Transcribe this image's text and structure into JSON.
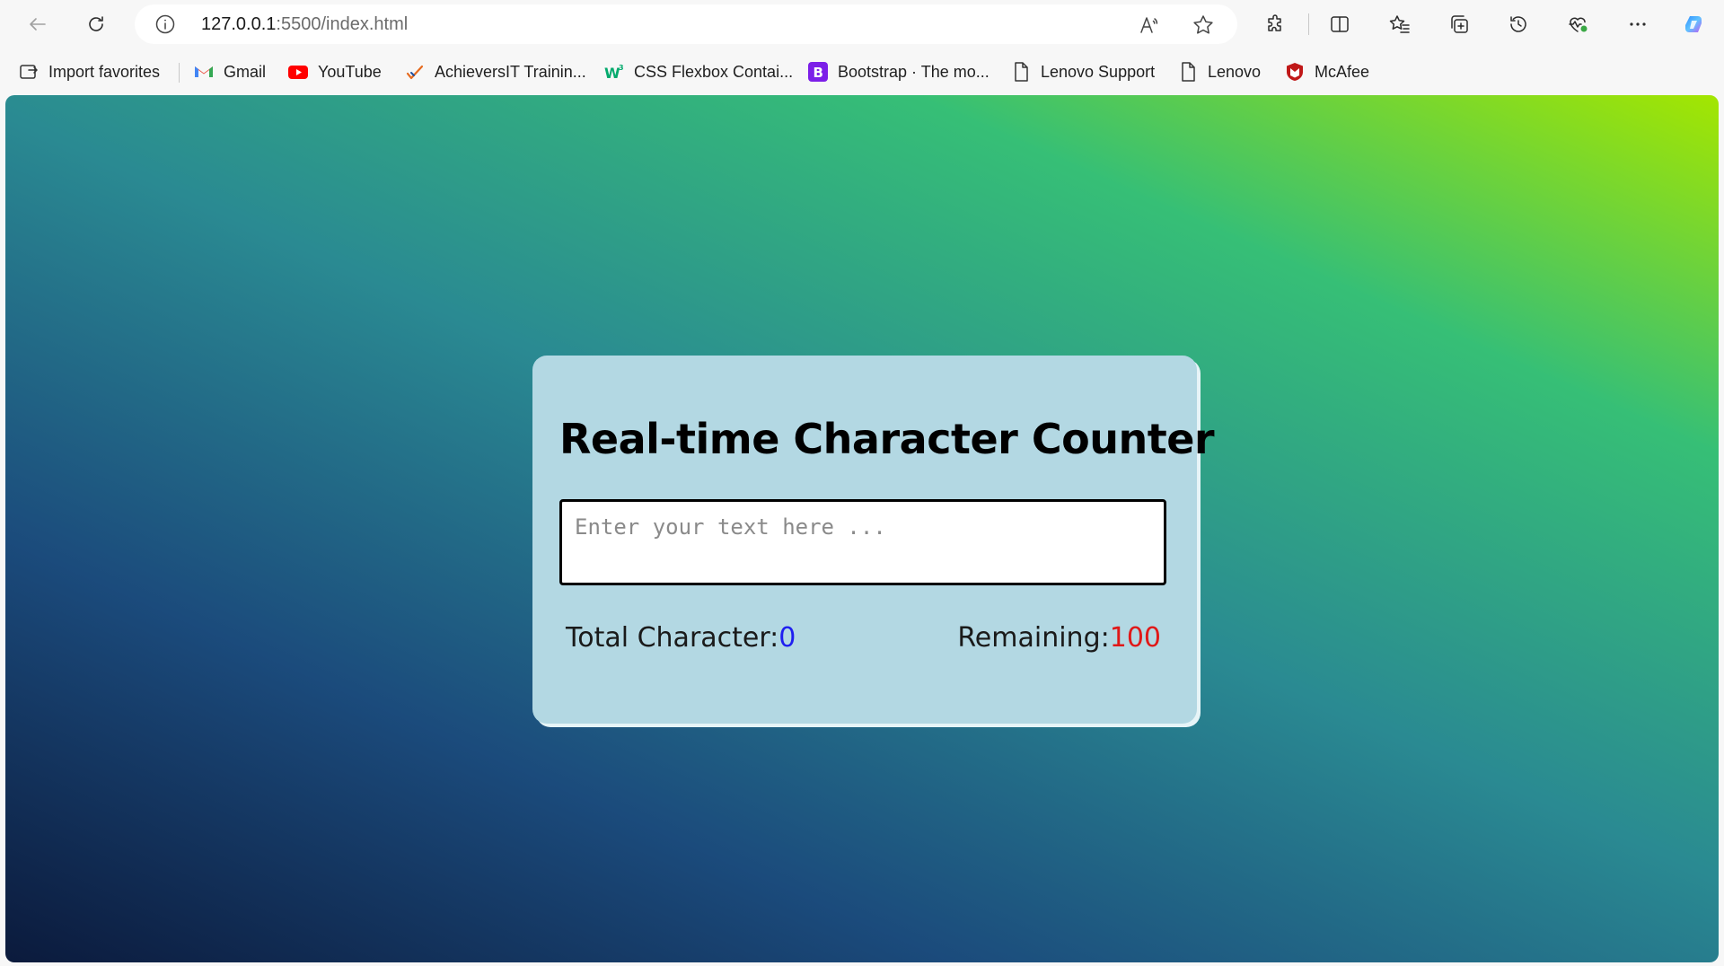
{
  "browser": {
    "url_host": "127.0.0.1",
    "url_path": ":5500/index.html"
  },
  "bookmarks": [
    {
      "label": "Import favorites",
      "icon": "import-favorites-icon"
    },
    {
      "label": "Gmail",
      "icon": "gmail-icon"
    },
    {
      "label": "YouTube",
      "icon": "youtube-icon"
    },
    {
      "label": "AchieversIT Trainin...",
      "icon": "achieversit-icon"
    },
    {
      "label": "CSS Flexbox Contai...",
      "icon": "w3schools-icon"
    },
    {
      "label": "Bootstrap · The mo...",
      "icon": "bootstrap-icon"
    },
    {
      "label": "Lenovo Support",
      "icon": "page-icon"
    },
    {
      "label": "Lenovo",
      "icon": "page-icon"
    },
    {
      "label": "McAfee",
      "icon": "mcafee-icon"
    }
  ],
  "page": {
    "title": "Real-time Character Counter",
    "textarea_placeholder": "Enter your text here ...",
    "total_label": "Total Character:",
    "total_value": "0",
    "remaining_label": "Remaining:",
    "remaining_value": "100"
  },
  "colors": {
    "card_bg": "#b3d8e3",
    "total_value": "#1f1ff0",
    "remaining_value": "#e01818",
    "gradient": [
      "#0b1a3c",
      "#1b4b7c",
      "#2a8a92",
      "#36bf76",
      "#a4e600"
    ]
  }
}
